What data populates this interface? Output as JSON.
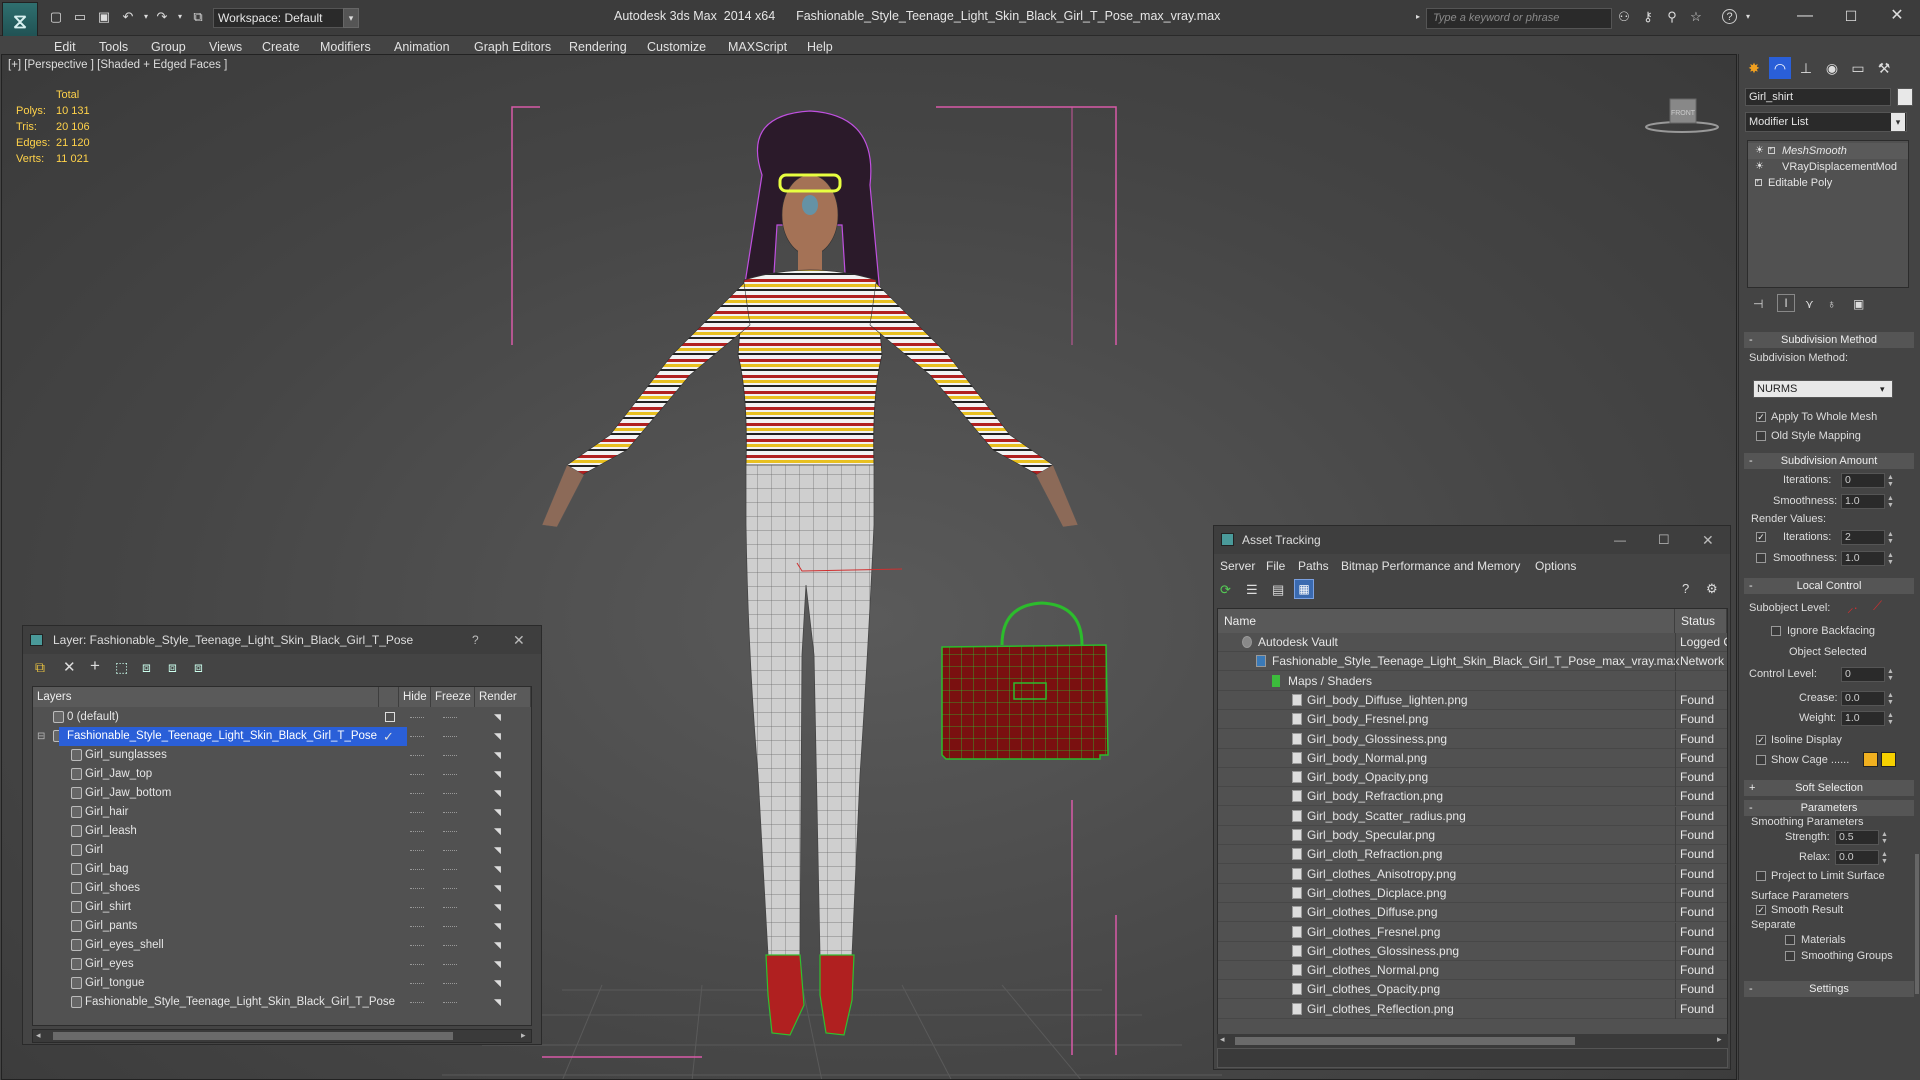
{
  "titlebar": {
    "workspace": "Workspace: Default",
    "app": "Autodesk 3ds Max  2014 x64",
    "file": "Fashionable_Style_Teenage_Light_Skin_Black_Girl_T_Pose_max_vray.max",
    "search_placeholder": "Type a keyword or phrase"
  },
  "menu": [
    "Edit",
    "Tools",
    "Group",
    "Views",
    "Create",
    "Modifiers",
    "Animation",
    "Graph Editors",
    "Rendering",
    "Customize",
    "MAXScript",
    "Help"
  ],
  "viewport": {
    "label": "[+] [Perspective ] [Shaded + Edged Faces ]",
    "stats": {
      "header": "Total",
      "rows": [
        {
          "k": "Polys:",
          "v": "10 131"
        },
        {
          "k": "Tris:",
          "v": "20 106"
        },
        {
          "k": "Edges:",
          "v": "21 120"
        },
        {
          "k": "Verts:",
          "v": "11 021"
        }
      ]
    },
    "viewcube_label": "FRONT"
  },
  "layer_panel": {
    "title": "Layer: Fashionable_Style_Teenage_Light_Skin_Black_Girl_T_Pose",
    "help": "?",
    "columns": {
      "layers": "Layers",
      "hide": "Hide",
      "freeze": "Freeze",
      "render": "Render"
    },
    "rows": [
      "0 (default)",
      "Fashionable_Style_Teenage_Light_Skin_Black_Girl_T_Pose",
      "Girl_sunglasses",
      "Girl_Jaw_top",
      "Girl_Jaw_bottom",
      "Girl_hair",
      "Girl_leash",
      "Girl",
      "Girl_bag",
      "Girl_shoes",
      "Girl_shirt",
      "Girl_pants",
      "Girl_eyes_shell",
      "Girl_eyes",
      "Girl_tongue",
      "Fashionable_Style_Teenage_Light_Skin_Black_Girl_T_Pose"
    ]
  },
  "asset_panel": {
    "title": "Asset Tracking",
    "menu": [
      "Server",
      "File",
      "Paths",
      "Bitmap Performance and Memory",
      "Options"
    ],
    "columns": {
      "name": "Name",
      "status": "Status"
    },
    "rows": [
      {
        "name": "Autodesk Vault",
        "status": "Logged O"
      },
      {
        "name": "Fashionable_Style_Teenage_Light_Skin_Black_Girl_T_Pose_max_vray.max",
        "status": "Network F"
      },
      {
        "name": "Maps / Shaders",
        "status": ""
      },
      {
        "name": "Girl_body_Diffuse_lighten.png",
        "status": "Found"
      },
      {
        "name": "Girl_body_Fresnel.png",
        "status": "Found"
      },
      {
        "name": "Girl_body_Glossiness.png",
        "status": "Found"
      },
      {
        "name": "Girl_body_Normal.png",
        "status": "Found"
      },
      {
        "name": "Girl_body_Opacity.png",
        "status": "Found"
      },
      {
        "name": "Girl_body_Refraction.png",
        "status": "Found"
      },
      {
        "name": "Girl_body_Scatter_radius.png",
        "status": "Found"
      },
      {
        "name": "Girl_body_Specular.png",
        "status": "Found"
      },
      {
        "name": "Girl_cloth_Refraction.png",
        "status": "Found"
      },
      {
        "name": "Girl_clothes_Anisotropy.png",
        "status": "Found"
      },
      {
        "name": "Girl_clothes_Dicplace.png",
        "status": "Found"
      },
      {
        "name": "Girl_clothes_Diffuse.png",
        "status": "Found"
      },
      {
        "name": "Girl_clothes_Fresnel.png",
        "status": "Found"
      },
      {
        "name": "Girl_clothes_Glossiness.png",
        "status": "Found"
      },
      {
        "name": "Girl_clothes_Normal.png",
        "status": "Found"
      },
      {
        "name": "Girl_clothes_Opacity.png",
        "status": "Found"
      },
      {
        "name": "Girl_clothes_Reflection.png",
        "status": "Found"
      }
    ]
  },
  "command_panel": {
    "object_name": "Girl_shirt",
    "modifier_list": "Modifier List",
    "stack": [
      "MeshSmooth",
      "VRayDisplacementMod",
      "Editable Poly"
    ],
    "subdivision_method": {
      "header": "Subdivision Method",
      "label": "Subdivision Method:",
      "value": "NURMS",
      "apply_whole_mesh": "Apply To Whole Mesh",
      "old_style": "Old Style Mapping"
    },
    "subdivision_amount": {
      "header": "Subdivision Amount",
      "iterations_label": "Iterations:",
      "iterations": "0",
      "smoothness_label": "Smoothness:",
      "smoothness": "1.0",
      "render_values": "Render Values:",
      "r_iterations_label": "Iterations:",
      "r_iterations": "2",
      "r_smoothness_label": "Smoothness:",
      "r_smoothness": "1.0"
    },
    "local_control": {
      "header": "Local Control",
      "subobject_level": "Subobject Level:",
      "ignore_backfacing": "Ignore Backfacing",
      "object_selected": "Object Selected",
      "control_level_label": "Control Level:",
      "control_level": "0",
      "crease_label": "Crease:",
      "crease": "0.0",
      "weight_label": "Weight:",
      "weight": "1.0",
      "isoline": "Isoline Display",
      "show_cage": "Show Cage ......"
    },
    "soft_selection": "Soft Selection",
    "parameters": {
      "header": "Parameters",
      "smoothing": "Smoothing Parameters",
      "strength_label": "Strength:",
      "strength": "0.5",
      "relax_label": "Relax:",
      "relax": "0.0",
      "project": "Project to Limit Surface",
      "surface": "Surface Parameters",
      "smooth_result": "Smooth Result",
      "separate": "Separate",
      "materials": "Materials",
      "smoothing_groups": "Smoothing Groups"
    },
    "settings": "Settings"
  },
  "colors": {
    "selection": "#2a5fd8",
    "wire_pink": "#d85aa8",
    "cage_1": "#f0b020",
    "cage_2": "#f6d000"
  }
}
